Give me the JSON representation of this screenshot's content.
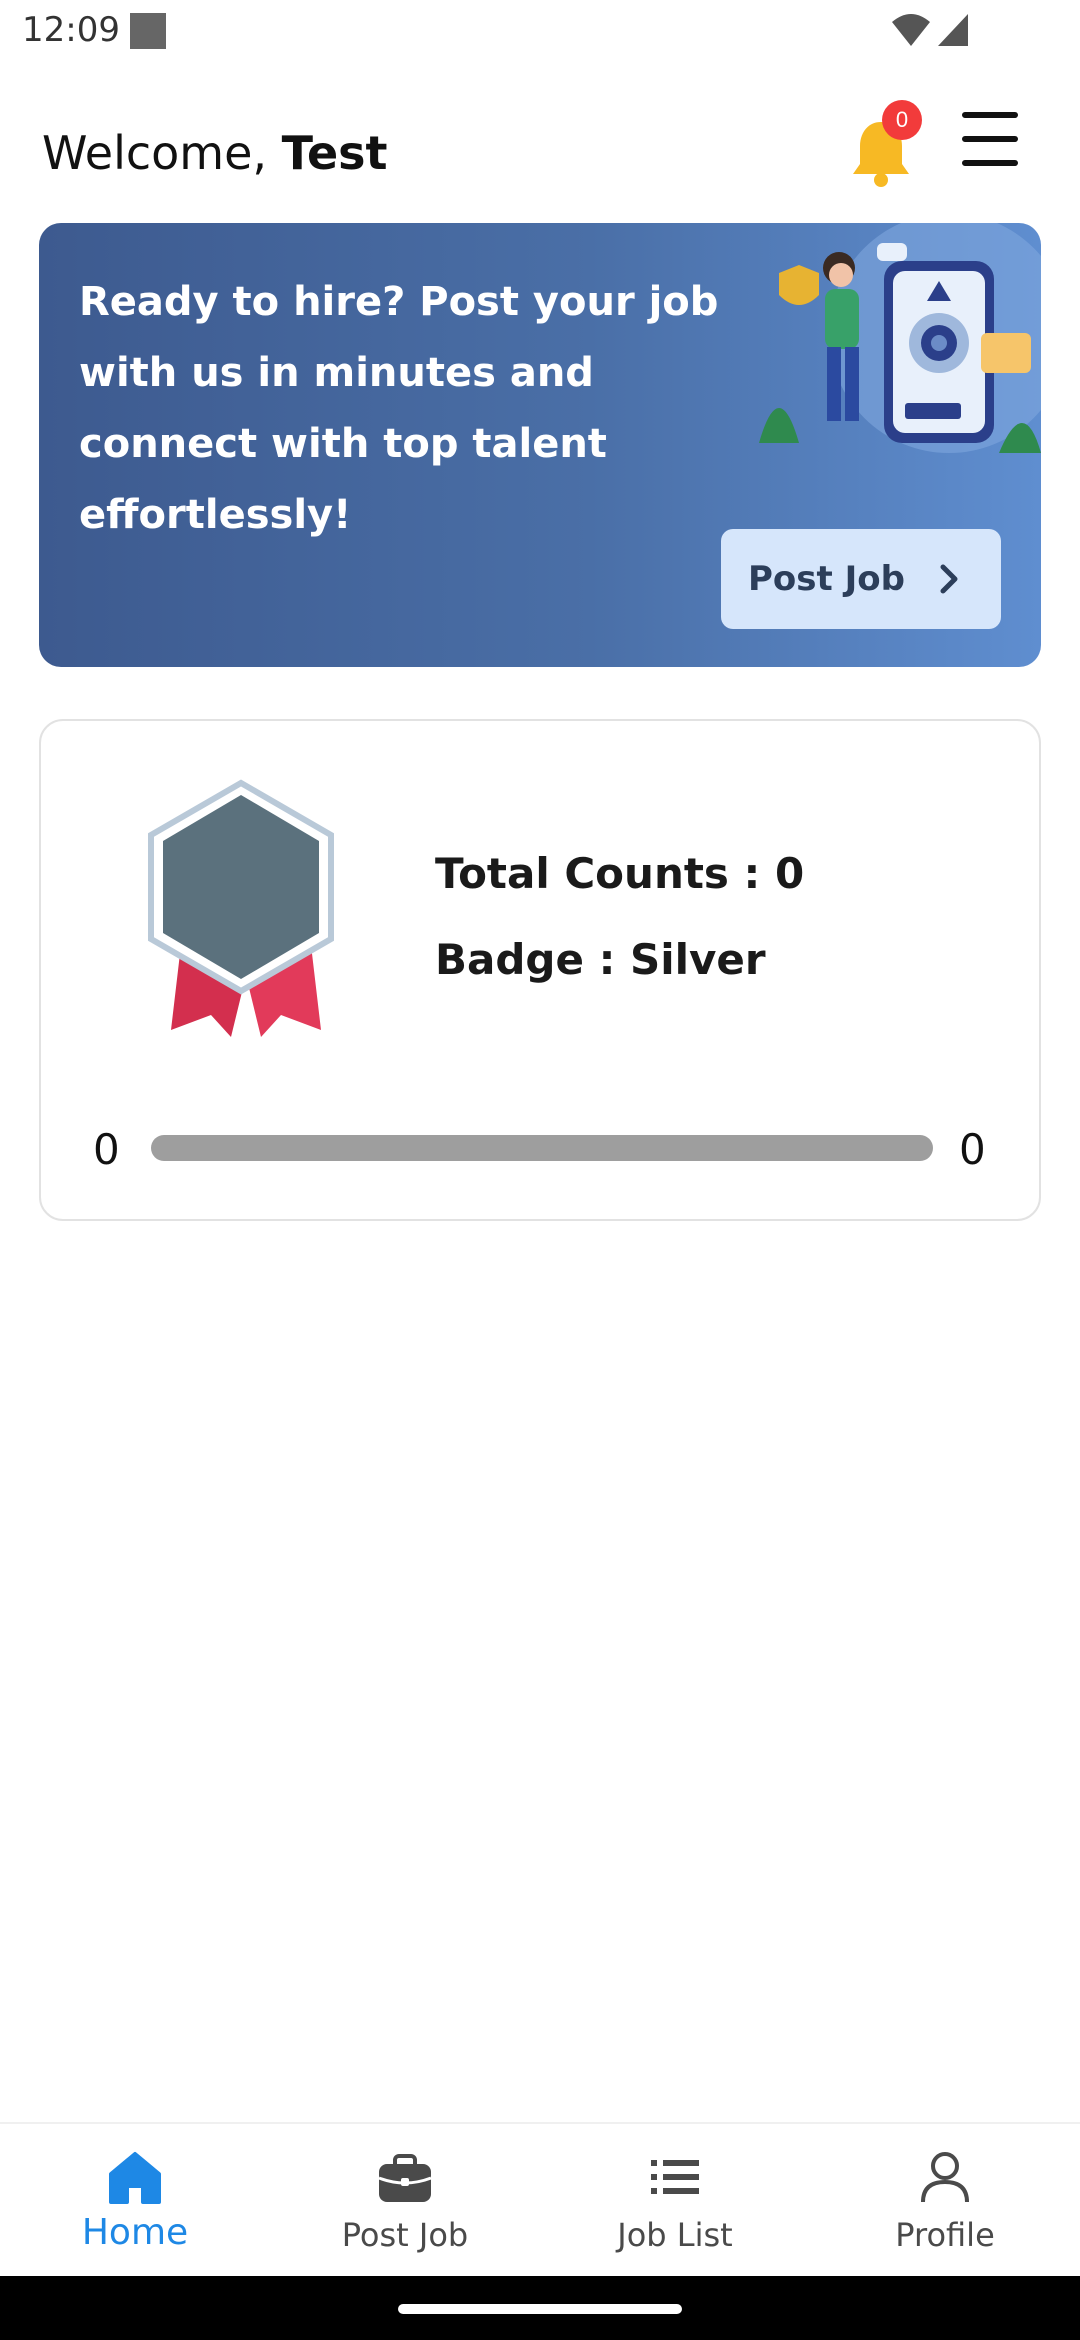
{
  "status_bar": {
    "time": "12:09"
  },
  "header": {
    "welcome_prefix": "Welcome, ",
    "user_name": "Test",
    "notification_count": "0",
    "bell_color": "#f7b924"
  },
  "hero": {
    "text": "Ready to hire? Post your job with us in minutes and connect with top talent effortlessly!",
    "button_label": "Post Job"
  },
  "badge_card": {
    "total_counts": "Total Counts : 0",
    "badge": "Badge : Silver",
    "progress_min": "0",
    "progress_max": "0",
    "progress_fraction": 0
  },
  "bottom_nav": {
    "items": [
      {
        "label": "Home",
        "icon": "home-icon",
        "active": true
      },
      {
        "label": "Post Job",
        "icon": "briefcase-icon",
        "active": false
      },
      {
        "label": "Job List",
        "icon": "list-icon",
        "active": false
      },
      {
        "label": "Profile",
        "icon": "person-icon",
        "active": false
      }
    ],
    "active_color": "#1e88e5"
  }
}
